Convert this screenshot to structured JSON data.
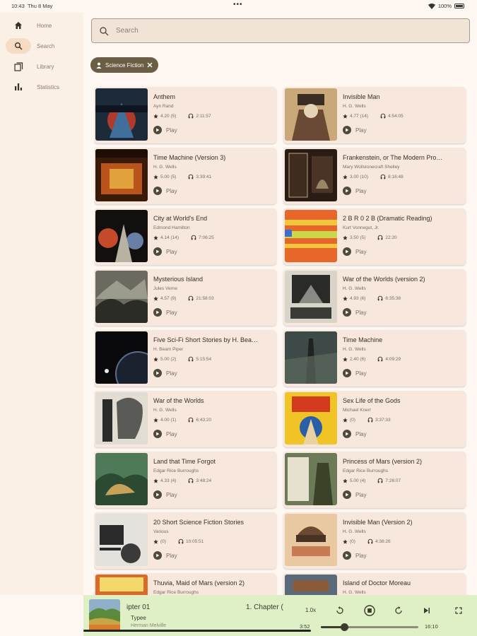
{
  "status": {
    "time": "10:43",
    "date": "Thu 8 May",
    "battery": "100%"
  },
  "nav": [
    {
      "label": "Home",
      "icon": "home-icon"
    },
    {
      "label": "Search",
      "icon": "search-icon",
      "active": true
    },
    {
      "label": "Library",
      "icon": "library-icon"
    },
    {
      "label": "Statistics",
      "icon": "statistics-icon"
    }
  ],
  "search": {
    "placeholder": "Search",
    "value": ""
  },
  "filter_chip": {
    "label": "Science Fiction"
  },
  "play_label": "Play",
  "books": [
    {
      "title": "Anthem",
      "author": "Ayn Rand",
      "rating": "4.20 (5)",
      "duration": "2:11:57"
    },
    {
      "title": "Invisible Man",
      "author": "H. G. Wells",
      "rating": "4.77 (14)",
      "duration": "4:54:05"
    },
    {
      "title": "Time Machine (Version 3)",
      "author": "H. G. Wells",
      "rating": "5.00 (5)",
      "duration": "3:39:41"
    },
    {
      "title": "Frankenstein, or The Modern Pro…",
      "author": "Mary Wollstonecraft Shelley",
      "rating": "3.00 (10)",
      "duration": "8:16:48"
    },
    {
      "title": "City at World's End",
      "author": "Edmond Hamilton",
      "rating": "4.14 (14)",
      "duration": "7:06:25"
    },
    {
      "title": "2 B R 0 2 B (Dramatic Reading)",
      "author": "Kurt Vonnegut, Jr.",
      "rating": "3.50 (5)",
      "duration": "22:20"
    },
    {
      "title": "Mysterious Island",
      "author": "Jules Verne",
      "rating": "4.57 (9)",
      "duration": "21:58:03"
    },
    {
      "title": "War of the Worlds (version 2)",
      "author": "H. G. Wells",
      "rating": "4.93 (6)",
      "duration": "6:35:38"
    },
    {
      "title": "Five Sci-Fi Short Stories by H. Bea…",
      "author": "H. Beam Piper",
      "rating": "5.00 (2)",
      "duration": "5:15:54"
    },
    {
      "title": "Time Machine",
      "author": "H. G. Wells",
      "rating": "2.40 (6)",
      "duration": "4:09:29"
    },
    {
      "title": "War of the Worlds",
      "author": "H. G. Wells",
      "rating": "4.00 (1)",
      "duration": "6:43:20"
    },
    {
      "title": "Sex Life of the Gods",
      "author": "Michael Knerr",
      "rating": "(0)",
      "duration": "3:37:33"
    },
    {
      "title": "Land that Time Forgot",
      "author": "Edgar Rice Burroughs",
      "rating": "4.33 (4)",
      "duration": "3:48:24"
    },
    {
      "title": "Princess of Mars (version 2)",
      "author": "Edgar Rice Burroughs",
      "rating": "5.00 (4)",
      "duration": "7:26:07"
    },
    {
      "title": "20 Short Science Fiction Stories",
      "author": "Various",
      "rating": "(0)",
      "duration": "10:05:51"
    },
    {
      "title": "Invisible Man (Version 2)",
      "author": "H. G. Wells",
      "rating": "(0)",
      "duration": "4:38:26"
    },
    {
      "title": "Thuvia, Maid of Mars (version 2)",
      "author": "Edgar Rice Burroughs",
      "rating": "",
      "duration": ""
    },
    {
      "title": "Island of Doctor Moreau",
      "author": "H. G. Wells",
      "rating": "",
      "duration": ""
    }
  ],
  "player": {
    "chapter": "ipter 01",
    "chapter_next": "1. Chapter (",
    "book_title": "Typee",
    "book_author": "Herman Melville",
    "speed": "1.0x",
    "elapsed": "3:52",
    "total": "16:10",
    "progress": 0.24
  },
  "colors": {
    "accent": "#6b5e45",
    "card_bg": "#f7e7dc",
    "player_bg": "#dff0c7"
  }
}
